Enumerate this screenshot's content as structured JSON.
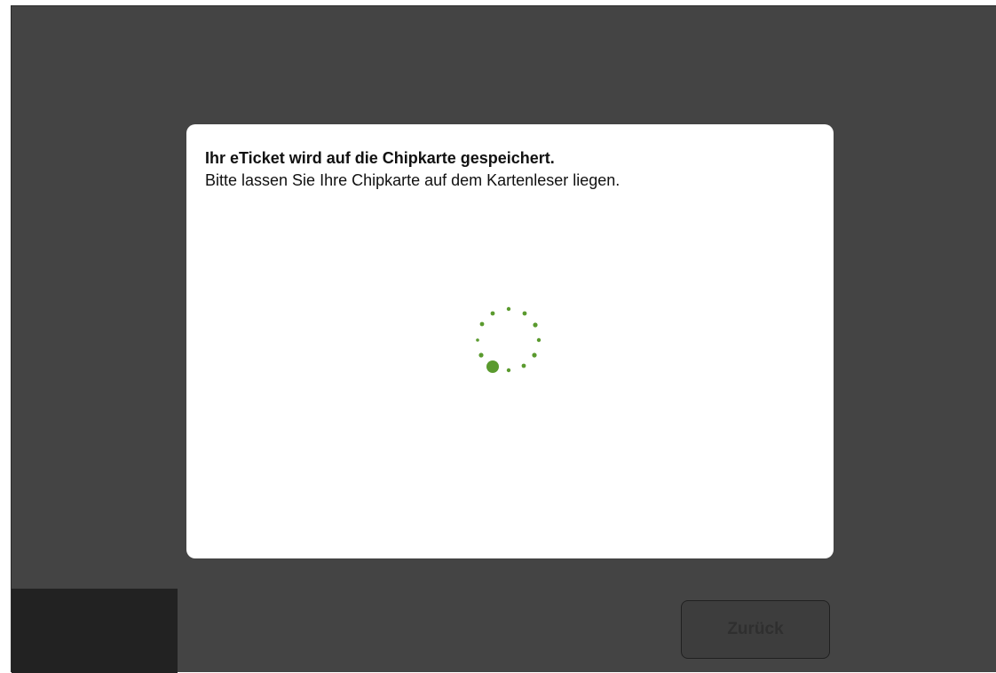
{
  "dialog": {
    "title": "Ihr eTicket wird auf die Chipkarte gespeichert.",
    "message": "Bitte lassen Sie Ihre Chipkarte auf dem Kartenleser liegen."
  },
  "spinner": {
    "icon": "loading-spinner-icon",
    "color": "#5a9a2e"
  },
  "footer": {
    "back_label": "Zurück"
  },
  "colors": {
    "background": "#444444",
    "panel_dark": "#222222",
    "dialog": "#ffffff",
    "accent": "#5a9a2e"
  }
}
